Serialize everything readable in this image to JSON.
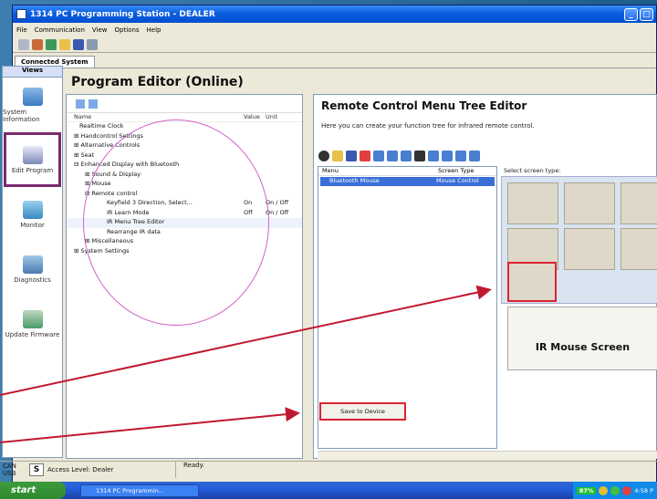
{
  "window": {
    "title": "1314 PC Programming Station - DEALER",
    "minimize": "_",
    "maximize": "□"
  },
  "menu": [
    "File",
    "Communication",
    "View",
    "Options",
    "Help"
  ],
  "tab": "Connected System",
  "views": {
    "title": "Views",
    "items": [
      "System Information",
      "Edit Program",
      "Monitor",
      "Diagnostics",
      "Update Firmware"
    ]
  },
  "editor": {
    "title": "Program Editor (Online)"
  },
  "tree": {
    "headers": {
      "name": "Name",
      "value": "Value",
      "unit": "Unit"
    },
    "rows": [
      {
        "name": "Realtime Clock",
        "value": "",
        "unit": ""
      },
      {
        "name": "⊞ Handcontrol Settings",
        "value": "",
        "unit": ""
      },
      {
        "name": "⊞ Alternative Controls",
        "value": "",
        "unit": ""
      },
      {
        "name": "⊞ Seat",
        "value": "",
        "unit": ""
      },
      {
        "name": "⊟ Enhanced Display with Bluetooth",
        "value": "",
        "unit": ""
      },
      {
        "name": "⊞ Sound & Display",
        "value": "",
        "unit": ""
      },
      {
        "name": "⊞ Mouse",
        "value": "",
        "unit": ""
      },
      {
        "name": "⊟ Remote control",
        "value": "",
        "unit": ""
      },
      {
        "name": "Keyfield 3 Direction, Select...",
        "value": "On",
        "unit": "On / Off"
      },
      {
        "name": "IR Learn Mode",
        "value": "Off",
        "unit": "On / Off"
      },
      {
        "name": "IR Menu Tree Editor",
        "value": "",
        "unit": ""
      },
      {
        "name": "Rearrange IR data",
        "value": "",
        "unit": ""
      },
      {
        "name": "⊞ Miscellaneous",
        "value": "",
        "unit": ""
      },
      {
        "name": "⊞ System Settings",
        "value": "",
        "unit": ""
      }
    ]
  },
  "remote": {
    "title": "Remote Control Menu Tree Editor",
    "description": "Here you can create your function tree for infrared remote control.",
    "menu_headers": {
      "menu": "Menu",
      "type": "Screen Type"
    },
    "menu_rows": [
      {
        "menu": "Bluetooth Mouse",
        "type": "Mouse Control"
      }
    ],
    "select_label": "Select screen type:",
    "preview_title": "IR Mouse Screen",
    "save_label": "Save to Device"
  },
  "status": {
    "connection": "CAN USB",
    "mode": "S",
    "access": "Access Level: Dealer",
    "ready": "Ready."
  },
  "taskbar": {
    "start": "start",
    "task": "1314 PC Programmin...",
    "battery": "87%",
    "clock": "4:58 P"
  },
  "colors": {
    "highlight": "#d02030",
    "circle": "#d060c8",
    "active_view": "#7a2a6e"
  }
}
